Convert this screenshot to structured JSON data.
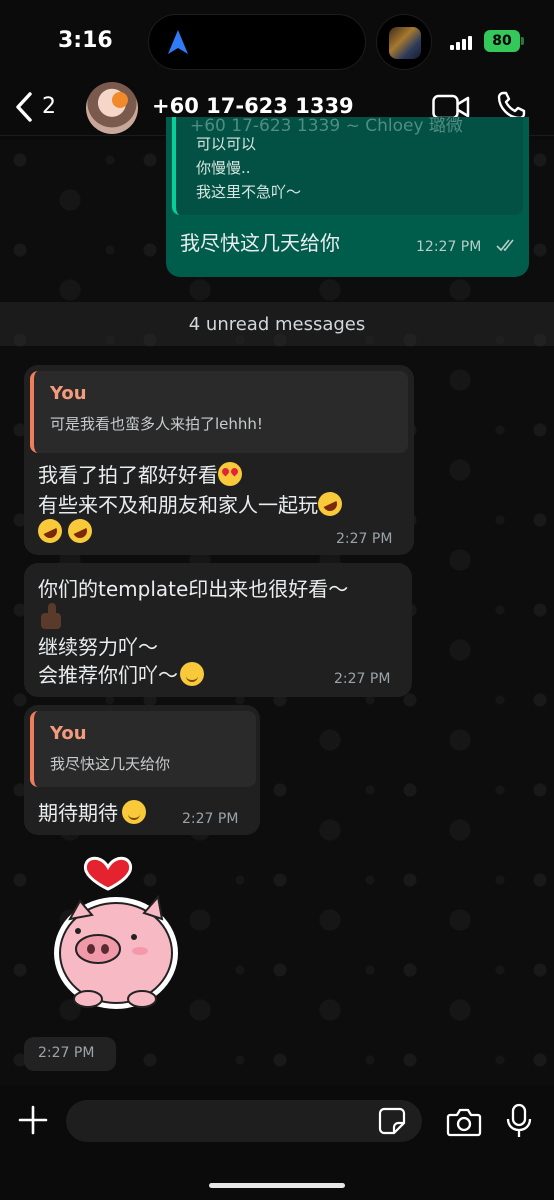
{
  "status_bar": {
    "time": "3:16",
    "battery": "80"
  },
  "header": {
    "back_count": "2",
    "contact_name": "+60 17-623 1339"
  },
  "outgoing": {
    "quote_header": "+60 17-623 1339 ~ Chloey 璐微",
    "quote_lines": [
      "可以可以",
      "你慢慢..",
      "我这里不急吖～"
    ],
    "text": "我尽快这几天给你",
    "time": "12:27 PM"
  },
  "unread_label": "4 unread messages",
  "messages": [
    {
      "quote_author": "You",
      "quote_text": "可是我看也蛮多人来拍了lehhh!",
      "lines": [
        "我看了拍了都好好看",
        "有些来不及和朋友和家人一起玩"
      ],
      "time": "2:27 PM"
    },
    {
      "lines": [
        "你们的template印出来也很好看～",
        "继续努力吖～",
        "会推荐你们吖～"
      ],
      "time": "2:27 PM"
    },
    {
      "quote_author": "You",
      "quote_text": "我尽快这几天给你",
      "lines": [
        "期待期待"
      ],
      "time": "2:27 PM"
    }
  ],
  "sticker": {
    "time": "2:27 PM",
    "icon": "pig-heart-sticker"
  },
  "input": {
    "placeholder": ""
  },
  "colors": {
    "outgoing_bubble": "#005c4b",
    "incoming_bubble": "#202020",
    "quote_accent_you": "#f07e5c",
    "quote_accent_out": "#06cf9c"
  }
}
